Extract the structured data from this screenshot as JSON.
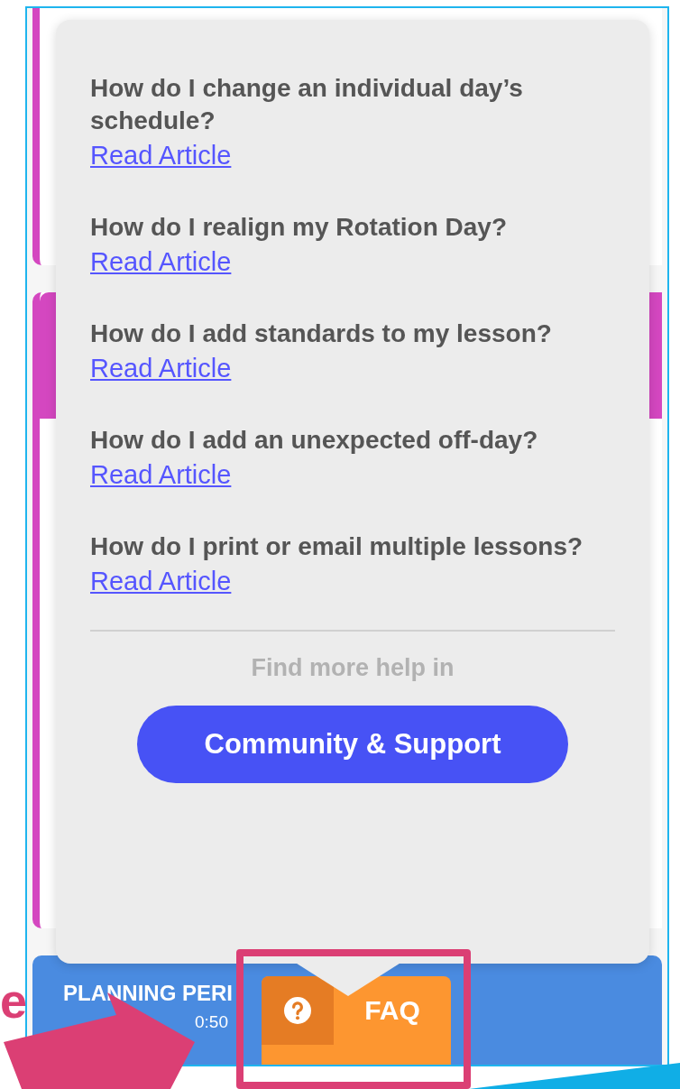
{
  "annotation": {
    "letter": "e"
  },
  "faq_popover": {
    "articles": [
      {
        "question": "How do I change an individual day’s schedule?",
        "link": "Read Article"
      },
      {
        "question": "How do I realign my Rotation Day?",
        "link": "Read Article"
      },
      {
        "question": "How do I add standards to my lesson?",
        "link": "Read Article"
      },
      {
        "question": "How do I add an unexpected off-day?",
        "link": "Read Article"
      },
      {
        "question": "How do I print or email multiple lessons?",
        "link": "Read Article"
      }
    ],
    "footer_text": "Find more help in",
    "button": "Community & Support"
  },
  "faq_tab": {
    "label": "FAQ"
  },
  "schedule": {
    "period_title": "PLANNING PERI",
    "time_end": "0:50"
  }
}
